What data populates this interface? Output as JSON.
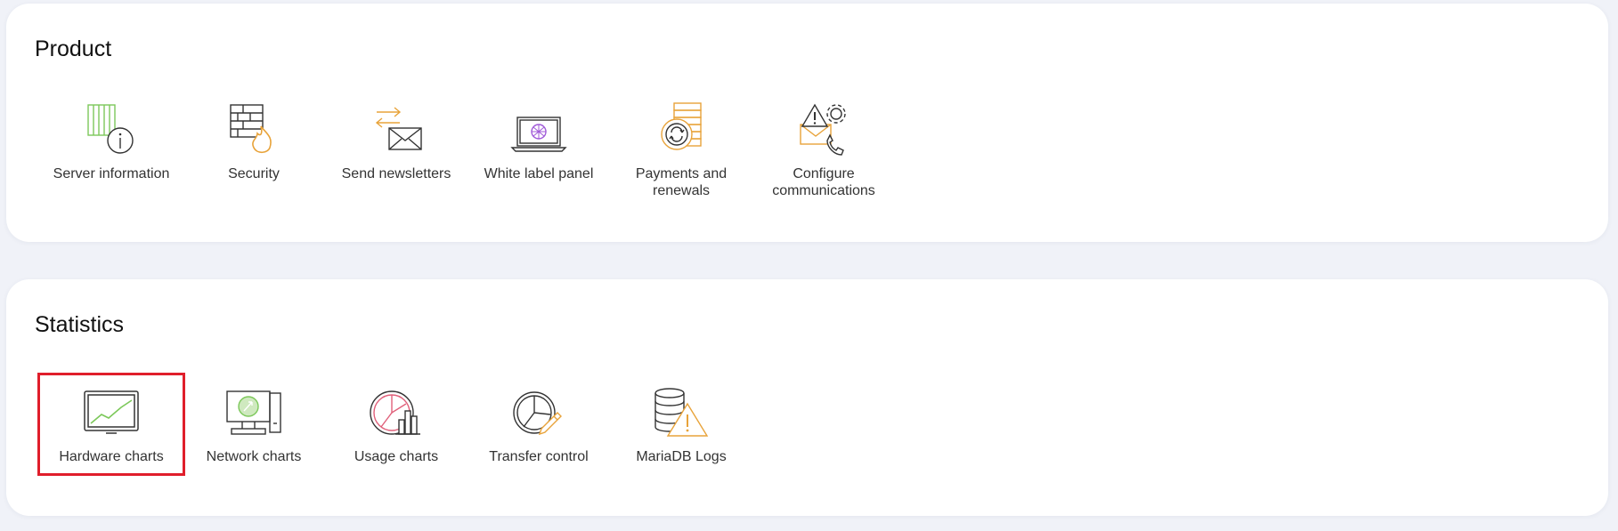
{
  "sections": [
    {
      "title": "Product",
      "items": [
        {
          "label": "Server information",
          "icon": "server-info-icon"
        },
        {
          "label": "Security",
          "icon": "firewall-icon"
        },
        {
          "label": "Send newsletters",
          "icon": "newsletter-icon"
        },
        {
          "label": "White label panel",
          "icon": "white-label-icon"
        },
        {
          "label": "Payments and renewals",
          "icon": "payments-icon"
        },
        {
          "label": "Configure communications",
          "icon": "communications-icon"
        }
      ]
    },
    {
      "title": "Statistics",
      "items": [
        {
          "label": "Hardware charts",
          "icon": "hardware-chart-icon",
          "selected": true
        },
        {
          "label": "Network charts",
          "icon": "network-chart-icon"
        },
        {
          "label": "Usage charts",
          "icon": "usage-chart-icon"
        },
        {
          "label": "Transfer control",
          "icon": "transfer-control-icon"
        },
        {
          "label": "MariaDB Logs",
          "icon": "mariadb-logs-icon"
        }
      ]
    }
  ],
  "colors": {
    "green": "#7cc85a",
    "orange": "#e8a33a",
    "purple": "#a05ad8",
    "pink": "#e0607a",
    "selection": "#e01e2b",
    "stroke": "#333333"
  }
}
